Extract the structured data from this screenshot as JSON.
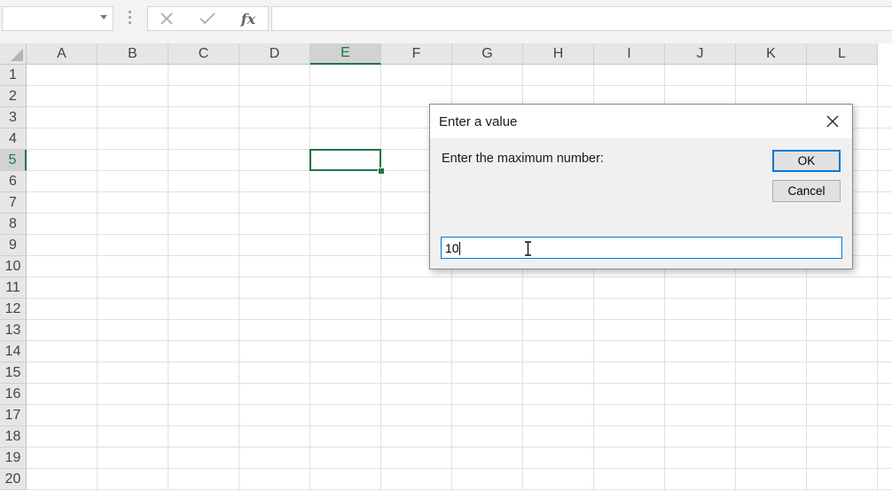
{
  "formula_bar": {
    "name_box_value": "",
    "formula_value": "",
    "icons": [
      "cancel-x-icon",
      "enter-check-icon",
      "fx-icon"
    ],
    "fx_label": "fx"
  },
  "sheet": {
    "columns": [
      "A",
      "B",
      "C",
      "D",
      "E",
      "F",
      "G",
      "H",
      "I",
      "J",
      "K",
      "L"
    ],
    "rows": [
      "1",
      "2",
      "3",
      "4",
      "5",
      "6",
      "7",
      "8",
      "9",
      "10",
      "11",
      "12",
      "13",
      "14",
      "15",
      "16",
      "17",
      "18",
      "19",
      "20"
    ],
    "selected_column": "E",
    "selected_row": "5",
    "accent_color": "#217346"
  },
  "dialog": {
    "title": "Enter a value",
    "prompt": "Enter the maximum number:",
    "ok_label": "OK",
    "cancel_label": "Cancel",
    "input_value": "10",
    "accent_color": "#0078d7"
  }
}
